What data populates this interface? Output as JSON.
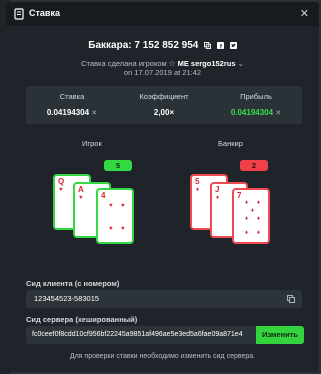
{
  "header": {
    "title": "Ставка",
    "close_icon": "close-icon"
  },
  "bet": {
    "label": "Баккара: 7 152 852 954"
  },
  "made_by": {
    "prefix": "Ставка сделана игроком",
    "username": "ME sergo152rus",
    "date": "on 17.07.2019 at 21:42"
  },
  "stats": {
    "bet_label": "Ставка",
    "bet_value": "0.04194304",
    "coef_label": "Коэффициент",
    "coef_value": "2,00×",
    "profit_label": "Прибыль",
    "profit_value": "0.04194304",
    "currency_mark": "✕"
  },
  "player": {
    "label": "Игрок",
    "score": "5",
    "cards": [
      "Q",
      "A",
      "4"
    ]
  },
  "banker": {
    "label": "Банкир",
    "score": "2",
    "cards": [
      "5",
      "J",
      "7"
    ]
  },
  "client_seed": {
    "label": "Сид клиента (с номером)",
    "value": "123454523-583015"
  },
  "server_seed": {
    "label": "Сид сервера (хешированный)",
    "value": "fc0ceef0f8cdd10cf956bf22245a9851af496ae5e3ed5a6fae09a871e4",
    "button": "Изменить"
  },
  "note": "Для проверки ставки необходимо изменить сид сервера.",
  "colors": {
    "green": "#36d844",
    "red": "#f04b52",
    "bg": "#1e2429"
  }
}
